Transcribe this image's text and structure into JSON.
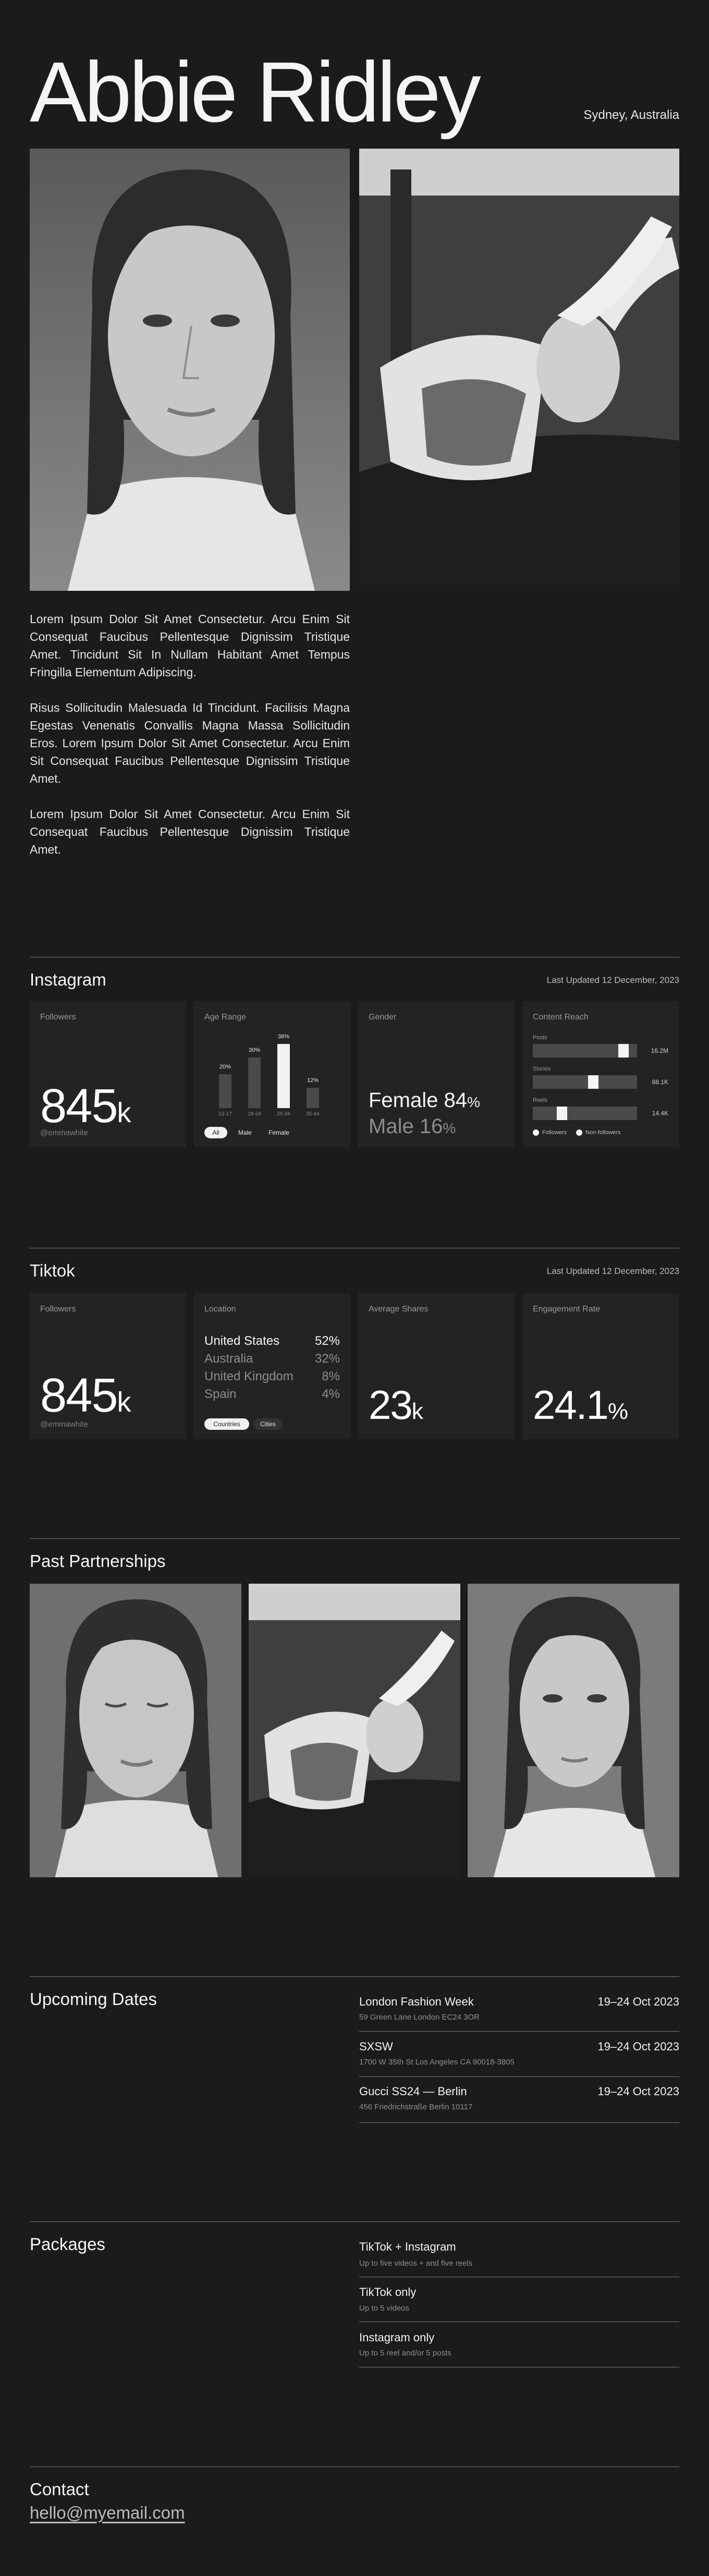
{
  "header": {
    "name": "Abbie Ridley",
    "location": "Sydney, Australia"
  },
  "bio": [
    "Lorem Ipsum Dolor Sit Amet Consectetur. Arcu Enim Sit Consequat Faucibus Pellentesque Dignissim Tristique Amet. Tincidunt Sit In Nullam Habitant Amet Tempus Fringilla Elementum Adipiscing.",
    "Risus Sollicitudin Malesuada Id Tincidunt. Facilisis Magna Egestas Venenatis Convallis Magna Massa Sollicitudin Eros. Lorem Ipsum Dolor Sit Amet Consectetur. Arcu Enim Sit Consequat Faucibus Pellentesque Dignissim Tristique Amet.",
    "Lorem Ipsum Dolor Sit Amet Consectetur. Arcu Enim Sit Consequat Faucibus Pellentesque Dignissim Tristique Amet."
  ],
  "instagram": {
    "title": "Instagram",
    "updated": "Last Updated 12 December, 2023",
    "followers": {
      "label": "Followers",
      "value": "845",
      "unit": "k",
      "handle": "@emmawhite"
    },
    "age": {
      "label": "Age Range",
      "chart_data": {
        "type": "bar",
        "categories": [
          "13-17",
          "18-24",
          "25-34",
          "35-44"
        ],
        "values": [
          20,
          30,
          38,
          12
        ],
        "value_labels": [
          "20%",
          "30%",
          "38%",
          "12%"
        ],
        "highlight_index": 2
      },
      "filters": [
        "All",
        "Male",
        "Female"
      ],
      "active_filter": "All"
    },
    "gender": {
      "label": "Gender",
      "female": {
        "name": "Female",
        "value": "84",
        "unit": "%"
      },
      "male": {
        "name": "Male",
        "value": "16",
        "unit": "%"
      }
    },
    "reach": {
      "label": "Content Reach",
      "rows": [
        {
          "name": "Posts",
          "value": "16.2M",
          "fraction": 0.92
        },
        {
          "name": "Stories",
          "value": "88.1K",
          "fraction": 0.63
        },
        {
          "name": "Reels",
          "value": "14.4K",
          "fraction": 0.33
        }
      ],
      "legend": [
        "Followers",
        "Non-followers"
      ]
    }
  },
  "tiktok": {
    "title": "Tiktok",
    "updated": "Last Updated 12 December, 2023",
    "followers": {
      "label": "Followers",
      "value": "845",
      "unit": "k",
      "handle": "@emmawhite"
    },
    "location": {
      "label": "Location",
      "rows": [
        {
          "name": "United States",
          "value": "52%"
        },
        {
          "name": "Australia",
          "value": "32%"
        },
        {
          "name": "United Kingdom",
          "value": "8%"
        },
        {
          "name": "Spain",
          "value": "4%"
        }
      ],
      "filters": [
        "Countries",
        "Cities"
      ],
      "active_filter": "Countries"
    },
    "shares": {
      "label": "Average Shares",
      "value": "23",
      "unit": "k"
    },
    "engagement": {
      "label": "Engagement Rate",
      "value": "24.1",
      "unit": "%"
    }
  },
  "partnerships": {
    "title": "Past Partnerships"
  },
  "dates": {
    "title": "Upcoming Dates",
    "items": [
      {
        "name": "London Fashion Week",
        "address": "59 Green Lane London EC24 3OR",
        "date": "19–24 Oct 2023"
      },
      {
        "name": "SXSW",
        "address": "1700 W 35th St Los Angeles CA 90018-3805",
        "date": "19–24 Oct 2023"
      },
      {
        "name": "Gucci SS24 — Berlin",
        "address": "456 Friedrichstraße Berlin 10117",
        "date": "19–24 Oct 2023"
      }
    ]
  },
  "packages": {
    "title": "Packages",
    "items": [
      {
        "name": "TikTok + Instagram",
        "desc": "Up to five videos + and five reels"
      },
      {
        "name": "TikTok only",
        "desc": "Up to 5 videos"
      },
      {
        "name": "Instagram only",
        "desc": "Up to 5 reel and/or 5 posts"
      }
    ]
  },
  "contact": {
    "title": "Contact",
    "email": "hello@myemail.com"
  }
}
